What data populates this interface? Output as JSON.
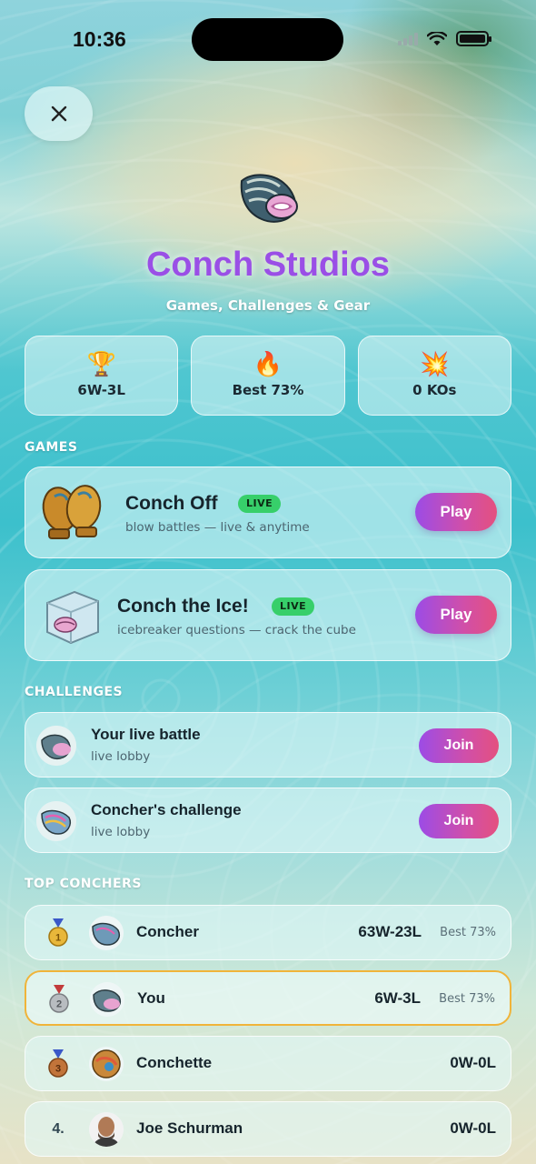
{
  "status_bar": {
    "time": "10:36"
  },
  "header": {
    "close_icon": "close-icon",
    "title": "Conch Studios",
    "subtitle": "Games, Challenges & Gear"
  },
  "stats": [
    {
      "icon": "🏆",
      "icon_name": "trophy-icon",
      "value": "6W-3L"
    },
    {
      "icon": "🔥",
      "icon_name": "fire-icon",
      "value": "Best 73%"
    },
    {
      "icon": "💥",
      "icon_name": "explosion-icon",
      "value": "0 KOs"
    }
  ],
  "games": {
    "section_label": "GAMES",
    "items": [
      {
        "name": "Conch Off",
        "badge": "LIVE",
        "description": "blow battles — live & anytime",
        "button": "Play"
      },
      {
        "name": "Conch the Ice!",
        "badge": "LIVE",
        "description": "icebreaker questions — crack the cube",
        "button": "Play"
      }
    ]
  },
  "challenges": {
    "section_label": "CHALLENGES",
    "items": [
      {
        "title": "Your live battle",
        "subtitle": "live lobby",
        "button": "Join"
      },
      {
        "title": "Concher's challenge",
        "subtitle": "live lobby",
        "button": "Join"
      }
    ]
  },
  "leaderboard": {
    "section_label": "TOP CONCHERS",
    "rows": [
      {
        "rank": "1",
        "medal": "gold",
        "name": "Concher",
        "record": "63W-23L",
        "best": "Best 73%"
      },
      {
        "rank": "2",
        "medal": "silver",
        "name": "You",
        "record": "6W-3L",
        "best": "Best 73%"
      },
      {
        "rank": "3",
        "medal": "bronze",
        "name": "Conchette",
        "record": "0W-0L",
        "best": ""
      },
      {
        "rank": "4.",
        "medal": "none",
        "name": "Joe Schurman",
        "record": "0W-0L",
        "best": ""
      }
    ]
  },
  "colors": {
    "title": "#9a4fe6",
    "button_gradient_start": "#9c4ce6",
    "button_gradient_end": "#e4507f",
    "live_badge": "#37cf6a",
    "highlight_border": "#f0b43a"
  }
}
